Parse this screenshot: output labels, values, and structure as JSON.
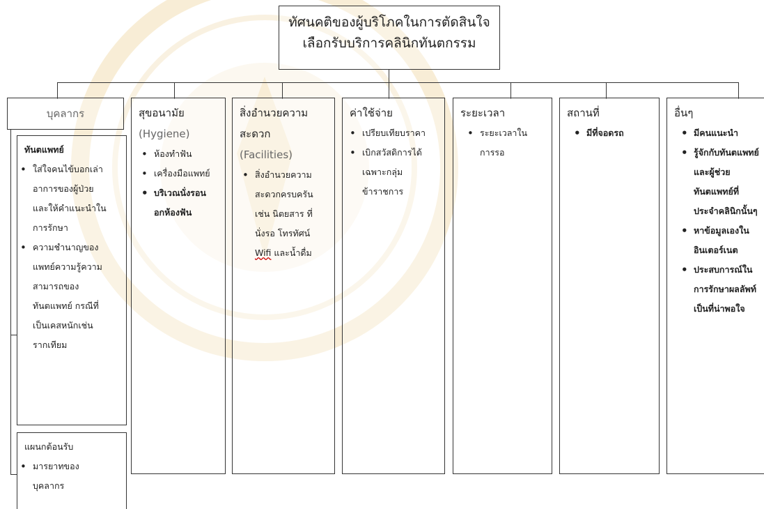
{
  "title": {
    "line1": "ทัศนคติของผู้บริโภคในการตัดสินใจ",
    "line2": "เลือกรับบริการคลินิกทันตกรรม"
  },
  "columns": {
    "personnel": {
      "label": "บุคลากร",
      "dentist": {
        "label": "ทันตแพทย์",
        "items": [
          "ใส่ใจคนไข้บอกเล่าอาการของผู้ป่วย และให้คำแนะนำในการรักษา",
          "ความชำนาญของแพทย์ความรู้ความสามารถของทันตแพทย์ กรณีที่เป็นเคสหนักเช่น รากเทียม"
        ]
      },
      "reception": {
        "label": "แผนกต้อนรับ",
        "items": [
          "มารยาทของบุคลากร"
        ]
      }
    },
    "hygiene": {
      "label": "สุขอนามัย",
      "sublabel": "(Hygiene)",
      "items": [
        "ห้องทำฟัน",
        "เครื่องมือแพทย์",
        "บริเวณนั่งรอนอกห้องฟัน"
      ]
    },
    "facilities": {
      "label": "สิ่งอำนวยความสะดวก",
      "sublabel": "(Facilities)",
      "items": [
        "สิ่งอำนวยความสะดวกครบครัน เช่น นิตยสาร ที่นั่งรอ โทรทัศน์",
        "Wifi",
        "และน้ำดื่ม"
      ]
    },
    "cost": {
      "label": "ค่าใช้จ่าย",
      "items": [
        "เปรียบเทียบราคา",
        "เบิกสวัสดิการได้เฉพาะกลุ่มข้าราชการ"
      ]
    },
    "duration": {
      "label": "ระยะเวลา",
      "items": [
        "ระยะเวลาในการรอ"
      ]
    },
    "location": {
      "label": "สถานที่",
      "items": [
        "มีที่จอดรถ"
      ]
    },
    "other": {
      "label": "อื่นๆ",
      "items": [
        "มีคนแนะนำ",
        "รู้จักกับทันตแพทย์และผู้ช่วยทันตแพทย์ที่ประจำคลินิกนั้นๆ",
        "หาข้อมูลเองในอินเตอร์เนต",
        "ประสบการณ์ในการรักษาผลลัพท์เป็นที่น่าพอใจ"
      ]
    }
  }
}
